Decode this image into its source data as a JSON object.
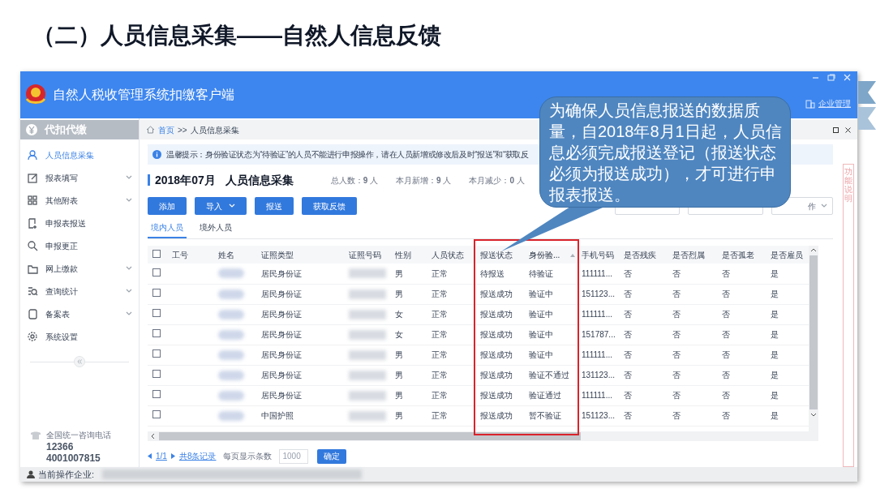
{
  "slide_title": "（二）人员信息采集——自然人信息反馈",
  "window": {
    "title": "自然人税收管理系统扣缴客户端",
    "account_menu": "企业管理"
  },
  "sidebar": {
    "header": "代扣代缴",
    "items": [
      {
        "label": "人员信息采集",
        "selected": true,
        "has_submenu": false
      },
      {
        "label": "报表填写",
        "selected": false,
        "has_submenu": true
      },
      {
        "label": "其他附表",
        "selected": false,
        "has_submenu": true
      },
      {
        "label": "申报表报送",
        "selected": false,
        "has_submenu": false
      },
      {
        "label": "申报更正",
        "selected": false,
        "has_submenu": false
      },
      {
        "label": "网上缴款",
        "selected": false,
        "has_submenu": true
      },
      {
        "label": "查询统计",
        "selected": false,
        "has_submenu": true
      },
      {
        "label": "备案表",
        "selected": false,
        "has_submenu": true
      },
      {
        "label": "系统设置",
        "selected": false,
        "has_submenu": false
      }
    ],
    "hotline_label": "全国统一咨询电话",
    "hotline_numbers": [
      "12366",
      "4001007815"
    ]
  },
  "breadcrumb": {
    "home": "首页",
    "separator": ">>",
    "current": "人员信息采集"
  },
  "notice": "温馨提示：身份验证状态为“待验证”的人员不能进行申报操作，请在人员新增或修改后及时“报送”和“获取反",
  "heading": {
    "period": "2018年07月",
    "title": "人员信息采集",
    "stats": [
      "总人数：**9** 人",
      "本月新增：**9** 人",
      "本月减少：**0** 人"
    ]
  },
  "buttons": [
    {
      "label": "添加",
      "dropdown": false
    },
    {
      "label": "导入",
      "dropdown": true
    },
    {
      "label": "报送",
      "dropdown": false
    },
    {
      "label": "获取反馈",
      "dropdown": false
    }
  ],
  "operation_dropdown": "作",
  "tabs": [
    {
      "label": "境内人员",
      "selected": true
    },
    {
      "label": "境外人员",
      "selected": false
    }
  ],
  "table": {
    "select_all_checked": false,
    "columns": [
      {
        "label": "工号",
        "sorted": false
      },
      {
        "label": "姓名",
        "sorted": false
      },
      {
        "label": "证照类型",
        "sorted": false
      },
      {
        "label": "证照号码",
        "sorted": false
      },
      {
        "label": "性别",
        "sorted": false
      },
      {
        "label": "人员状态",
        "sorted": false
      },
      {
        "label": "报送状态",
        "sorted": false
      },
      {
        "label": "身份验...",
        "sorted": true
      },
      {
        "label": "手机号码",
        "sorted": false
      },
      {
        "label": "是否残疾",
        "sorted": false
      },
      {
        "label": "是否烈属",
        "sorted": false
      },
      {
        "label": "是否孤老",
        "sorted": false
      },
      {
        "label": "是否雇员",
        "sorted": false
      }
    ],
    "rows": [
      {
        "checked": false,
        "id_type": "居民身份证",
        "gender": "男",
        "person_status": "正常",
        "report_status": "待报送",
        "verify_status": "待验证",
        "phone": "111111...",
        "disability": "否",
        "martyr_family": "否",
        "lonely_elderly": "否",
        "employee": "是"
      },
      {
        "checked": false,
        "id_type": "居民身份证",
        "gender": "男",
        "person_status": "正常",
        "report_status": "报送成功",
        "verify_status": "验证中",
        "phone": "151123...",
        "disability": "否",
        "martyr_family": "否",
        "lonely_elderly": "否",
        "employee": "是"
      },
      {
        "checked": false,
        "id_type": "居民身份证",
        "gender": "女",
        "person_status": "正常",
        "report_status": "报送成功",
        "verify_status": "验证中",
        "phone": "111111...",
        "disability": "否",
        "martyr_family": "否",
        "lonely_elderly": "否",
        "employee": "是"
      },
      {
        "checked": false,
        "id_type": "居民身份证",
        "gender": "女",
        "person_status": "正常",
        "report_status": "报送成功",
        "verify_status": "验证中",
        "phone": "151787...",
        "disability": "否",
        "martyr_family": "否",
        "lonely_elderly": "否",
        "employee": "是"
      },
      {
        "checked": false,
        "id_type": "居民身份证",
        "gender": "男",
        "person_status": "正常",
        "report_status": "报送成功",
        "verify_status": "验证中",
        "phone": "111111...",
        "disability": "否",
        "martyr_family": "否",
        "lonely_elderly": "否",
        "employee": "是"
      },
      {
        "checked": false,
        "id_type": "居民身份证",
        "gender": "男",
        "person_status": "正常",
        "report_status": "报送成功",
        "verify_status": "验证不通过",
        "phone": "131123...",
        "disability": "否",
        "martyr_family": "否",
        "lonely_elderly": "否",
        "employee": "是"
      },
      {
        "checked": false,
        "id_type": "居民身份证",
        "gender": "男",
        "person_status": "正常",
        "report_status": "报送成功",
        "verify_status": "验证通过",
        "phone": "111111...",
        "disability": "否",
        "martyr_family": "否",
        "lonely_elderly": "否",
        "employee": "是"
      },
      {
        "checked": false,
        "id_type": "中国护照",
        "gender": "男",
        "person_status": "正常",
        "report_status": "报送成功",
        "verify_status": "暂不验证",
        "phone": "151123...",
        "disability": "否",
        "martyr_family": "否",
        "lonely_elderly": "否",
        "employee": "是"
      }
    ]
  },
  "pagination": {
    "page": "1/1",
    "total": "共8条记录",
    "page_size_label": "每页显示条数",
    "page_size": "1000",
    "confirm": "确定"
  },
  "status_bar": {
    "label": "当前操作企业:"
  },
  "side_tab": "功能说明",
  "callout": {
    "text": "为确保人员信息报送的数据质量，自2018年8月1日起，人员信息必须完成报送登记（报送状态必须为报送成功），才可进行申报表报送。"
  }
}
